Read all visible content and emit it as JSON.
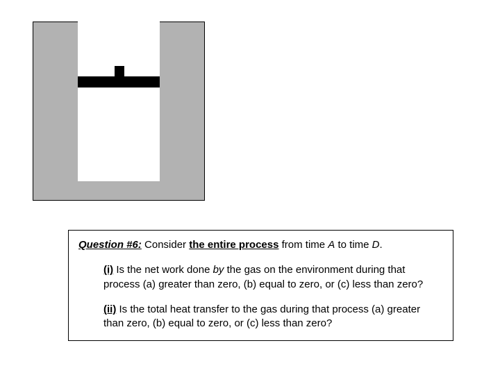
{
  "diagram": {
    "description": "piston-cylinder-apparatus"
  },
  "question": {
    "title_prefix": "Question #6:",
    "title_mid1": " Consider ",
    "title_underlined": "the entire process",
    "title_mid2": " from time ",
    "time_a": "A",
    "title_mid3": " to time ",
    "time_d": "D",
    "title_end": "."
  },
  "part_i": {
    "label": "(i)",
    "text_1": " Is the net work done ",
    "by": "by",
    "text_2": " the gas on the environment during that process (a) greater than zero, (b) equal to zero, or (c) less than zero?"
  },
  "part_ii": {
    "label": "(ii)",
    "text": " Is the total heat transfer to the gas during that process (a) greater than zero, (b) equal to zero, or (c) less than zero?"
  }
}
